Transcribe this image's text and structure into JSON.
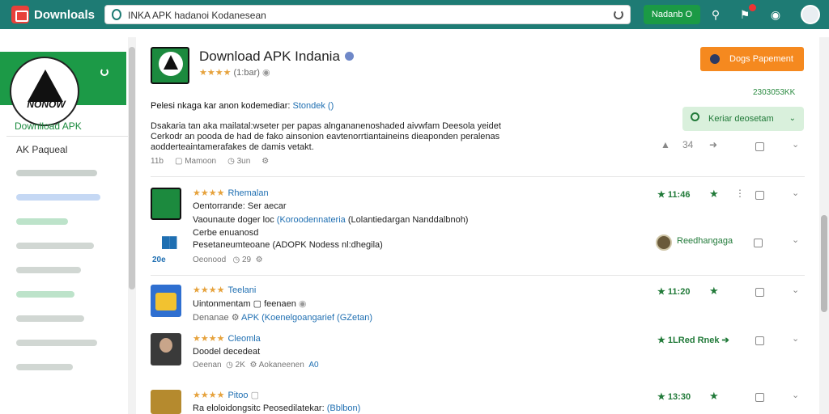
{
  "topbar": {
    "brand": "Downloals",
    "search_value": "INKA APK hadanoi Kodanesean",
    "button_label": "Nadanb O",
    "icons": [
      "search-icon",
      "bell-icon",
      "settings-icon",
      "profile-icon"
    ]
  },
  "sidebar": {
    "logo_text": "NONOW",
    "active_item": "Downlload APK",
    "item_label": "AK Paqueal"
  },
  "header": {
    "title": "Download APK Indania",
    "rating_text": "(1:bar)",
    "cta_label": "Dogs Papement",
    "count": "2303053KK",
    "green_button": "Keriar deosetam",
    "post_head": "Pelesi nkaga kar anon kodemediar:",
    "post_head_link": "Stondek ()",
    "post_body": "Dsakaria tan aka mailatal:wseter per papas alngananenoshaded aivwfam Deesola yeidet Cerkodr an pooda de had de fako ainsonion eavtenorrtiantaineins dieaponden peralenas aodderteaintamerafakes de damis vetakt.",
    "meta": [
      "11b",
      "Mamoon",
      "3un"
    ],
    "action_count": "34"
  },
  "rows": [
    {
      "name": "Rhemalan",
      "line1": "Oentorrande: Ser aecar",
      "line2_prefix": "Vaounaute doger loc",
      "line2_link": "(Koroodennateria",
      "line2_suffix": "(Lolantiedargan Nanddalbnoh)",
      "line3": "Cerbe enuanosd",
      "line4": "Pesetaneumteoane (ADOPK Nodess nl:dhegila)",
      "meta": [
        "Oeonood",
        "29"
      ],
      "score": "11:46",
      "user": "Reedhangaga",
      "label": "20e"
    },
    {
      "name": "Teelani",
      "line1": "Uintonmentam",
      "line1_tail": "feenaen",
      "line2": "Denanae",
      "line2_link": "APK (Koenelgoangarief (GZetan)",
      "score": "11:20"
    },
    {
      "name": "Cleomla",
      "line1": "Doodel decedeat",
      "meta": [
        "Oeenan",
        "2K",
        "Aokaneenen",
        "A0"
      ],
      "score": "1LRed Rnek"
    },
    {
      "name": "Pitoo",
      "line1_prefix": "Ra eloloidongsitc Peosedilatekar:",
      "line1_link": "(Bblbon)",
      "score": "13:30"
    }
  ]
}
